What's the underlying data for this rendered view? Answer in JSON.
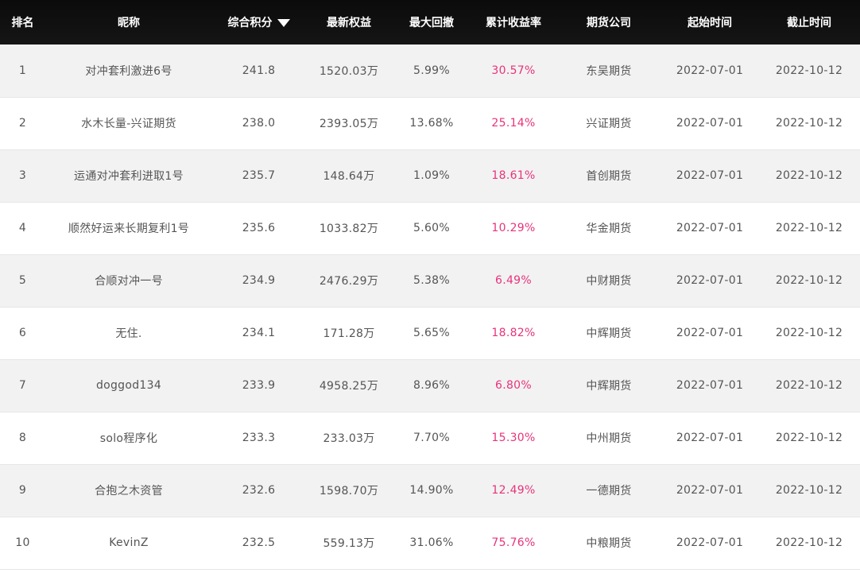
{
  "header": {
    "rank": "排名",
    "nickname": "昵称",
    "score": "综合积分",
    "equity": "最新权益",
    "drawdown": "最大回撤",
    "return_rate": "累计收益率",
    "company": "期货公司",
    "start": "起始时间",
    "end": "截止时间",
    "sort_icon": "caret-down-icon"
  },
  "colors": {
    "header_bg": "#0b0b0b",
    "rate_color": "#e8337a",
    "row_alt": "#f2f2f2"
  },
  "rows": [
    {
      "rank": "1",
      "nickname": "对冲套利激进6号",
      "score": "241.8",
      "equity": "1520.03万",
      "drawdown": "5.99%",
      "return_rate": "30.57%",
      "company": "东吴期货",
      "start": "2022-07-01",
      "end": "2022-10-12"
    },
    {
      "rank": "2",
      "nickname": "水木长量-兴证期货",
      "score": "238.0",
      "equity": "2393.05万",
      "drawdown": "13.68%",
      "return_rate": "25.14%",
      "company": "兴证期货",
      "start": "2022-07-01",
      "end": "2022-10-12"
    },
    {
      "rank": "3",
      "nickname": "运通对冲套利进取1号",
      "score": "235.7",
      "equity": "148.64万",
      "drawdown": "1.09%",
      "return_rate": "18.61%",
      "company": "首创期货",
      "start": "2022-07-01",
      "end": "2022-10-12"
    },
    {
      "rank": "4",
      "nickname": "顺然好运来长期复利1号",
      "score": "235.6",
      "equity": "1033.82万",
      "drawdown": "5.60%",
      "return_rate": "10.29%",
      "company": "华金期货",
      "start": "2022-07-01",
      "end": "2022-10-12"
    },
    {
      "rank": "5",
      "nickname": "合顺对冲一号",
      "score": "234.9",
      "equity": "2476.29万",
      "drawdown": "5.38%",
      "return_rate": "6.49%",
      "company": "中财期货",
      "start": "2022-07-01",
      "end": "2022-10-12"
    },
    {
      "rank": "6",
      "nickname": "无住.",
      "score": "234.1",
      "equity": "171.28万",
      "drawdown": "5.65%",
      "return_rate": "18.82%",
      "company": "中辉期货",
      "start": "2022-07-01",
      "end": "2022-10-12"
    },
    {
      "rank": "7",
      "nickname": "doggod134",
      "score": "233.9",
      "equity": "4958.25万",
      "drawdown": "8.96%",
      "return_rate": "6.80%",
      "company": "中辉期货",
      "start": "2022-07-01",
      "end": "2022-10-12"
    },
    {
      "rank": "8",
      "nickname": "solo程序化",
      "score": "233.3",
      "equity": "233.03万",
      "drawdown": "7.70%",
      "return_rate": "15.30%",
      "company": "中州期货",
      "start": "2022-07-01",
      "end": "2022-10-12"
    },
    {
      "rank": "9",
      "nickname": "合抱之木资管",
      "score": "232.6",
      "equity": "1598.70万",
      "drawdown": "14.90%",
      "return_rate": "12.49%",
      "company": "一德期货",
      "start": "2022-07-01",
      "end": "2022-10-12"
    },
    {
      "rank": "10",
      "nickname": "KevinZ",
      "score": "232.5",
      "equity": "559.13万",
      "drawdown": "31.06%",
      "return_rate": "75.76%",
      "company": "中粮期货",
      "start": "2022-07-01",
      "end": "2022-10-12"
    }
  ]
}
